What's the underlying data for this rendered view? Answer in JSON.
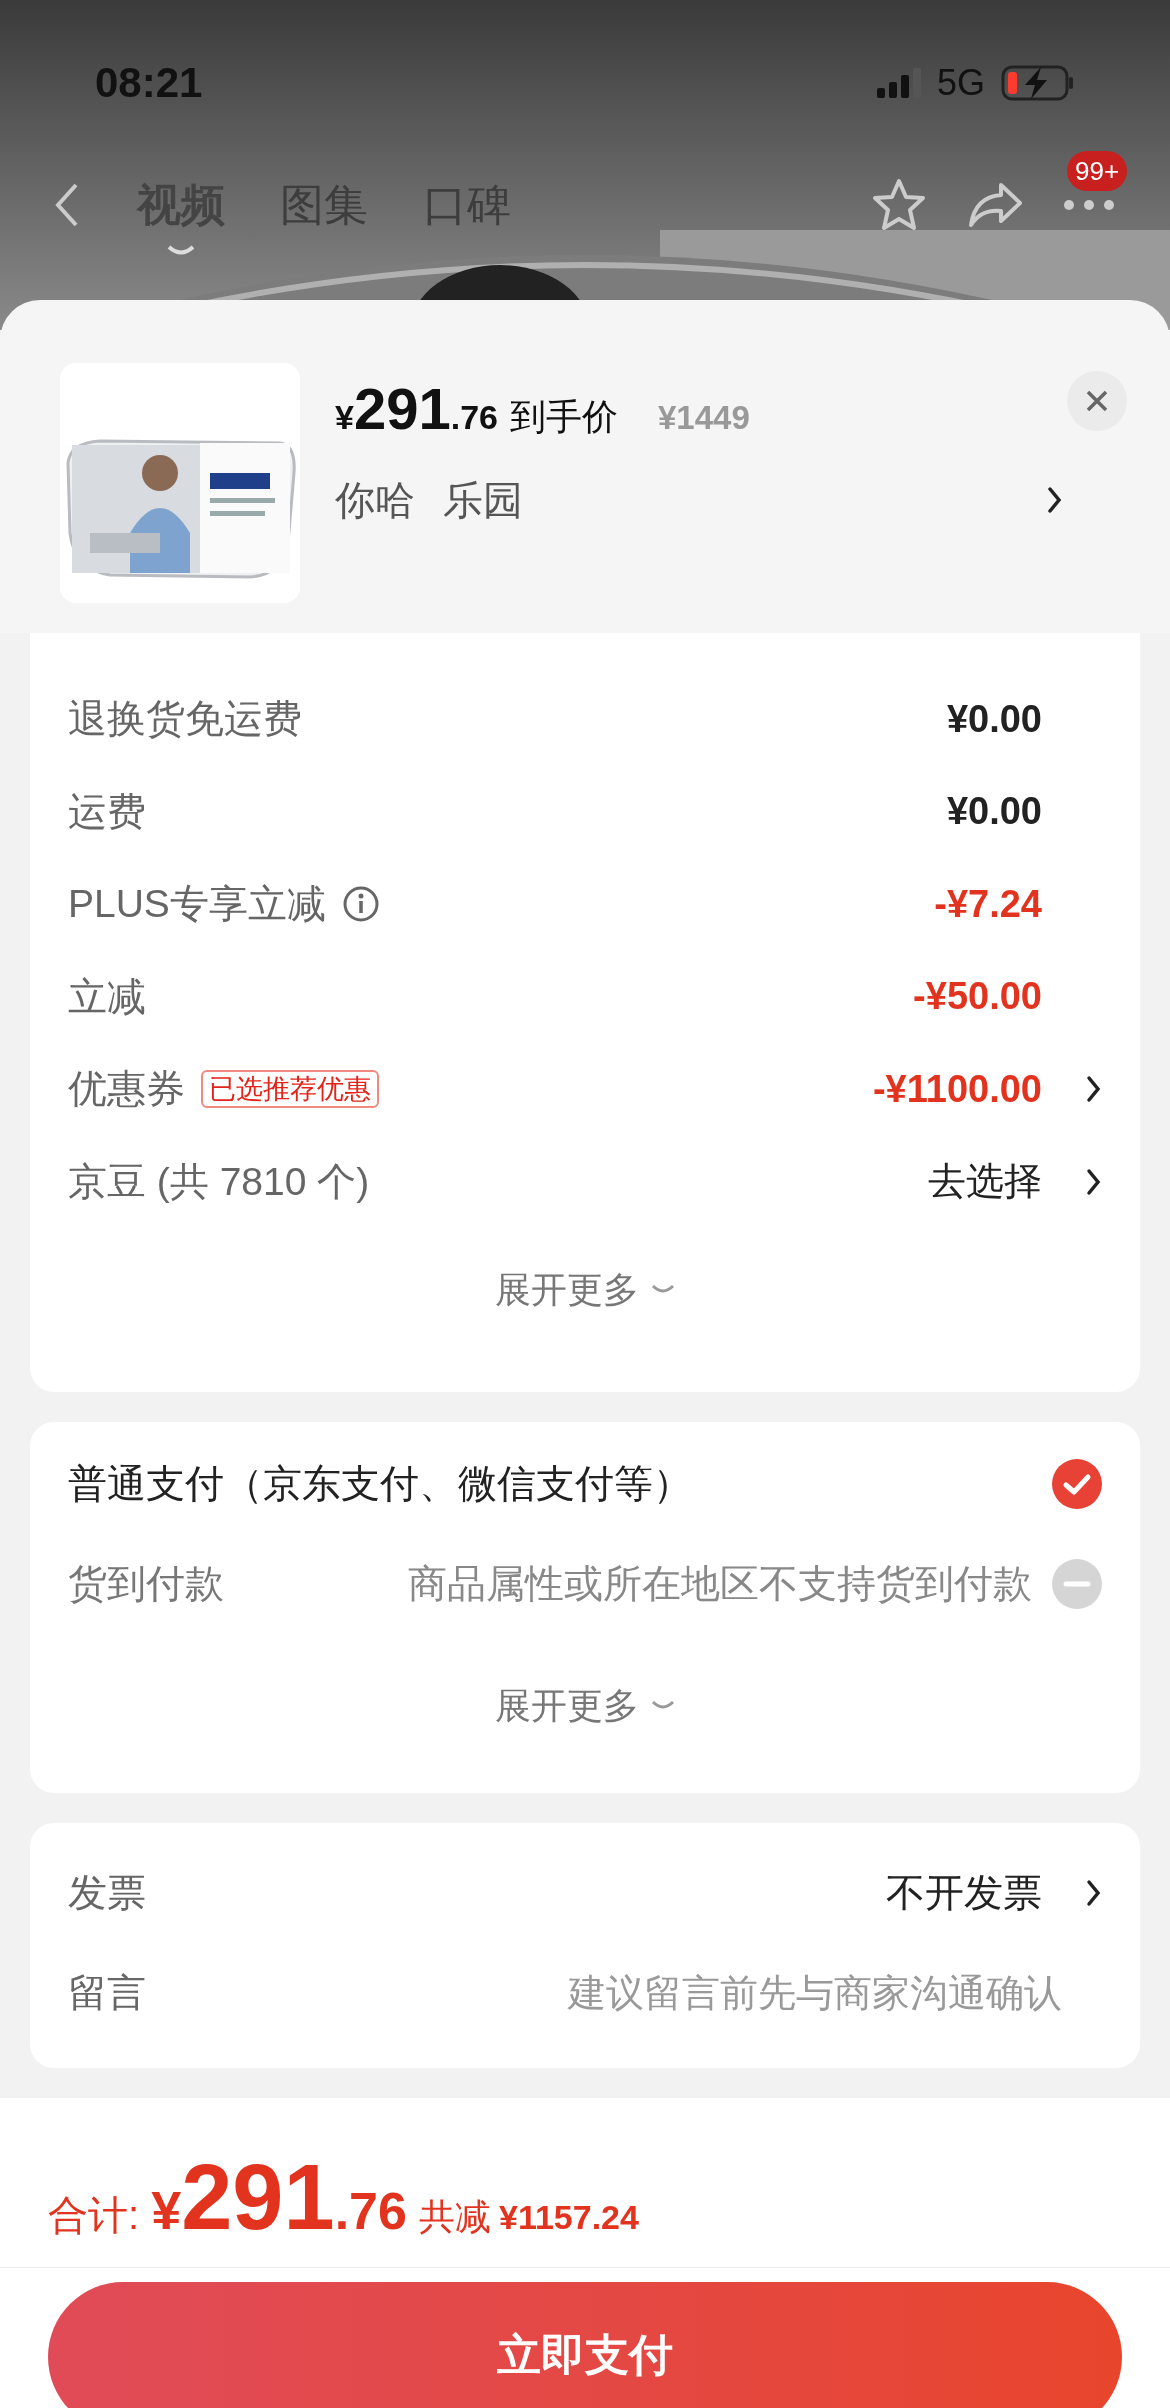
{
  "status_bar": {
    "time": "08:21",
    "network": "5G"
  },
  "nav": {
    "tabs": [
      {
        "label": "视频",
        "selected": true
      },
      {
        "label": "图集",
        "selected": false
      },
      {
        "label": "口碑",
        "selected": false
      }
    ],
    "badge": "99+"
  },
  "product": {
    "currency": "¥",
    "price_int": "291",
    "price_dec": ".76",
    "price_label": "到手价",
    "original_price": "¥1449",
    "variants": [
      "你哈",
      "乐园"
    ]
  },
  "charges": [
    {
      "label": "退换货免运费",
      "value": "¥0.00",
      "highlight": false,
      "link": false
    },
    {
      "label": "运费",
      "value": "¥0.00",
      "highlight": false,
      "link": false
    },
    {
      "label": "PLUS专享立减",
      "value": "-¥7.24",
      "highlight": true,
      "info": true,
      "link": false
    },
    {
      "label": "立减",
      "value": "-¥50.00",
      "highlight": true,
      "link": false
    },
    {
      "label": "优惠券",
      "tag": "已选推荐优惠",
      "value": "-¥1100.00",
      "highlight": true,
      "link": true
    },
    {
      "label": "京豆 (共 7810 个)",
      "value": "去选择",
      "highlight": false,
      "link": true
    }
  ],
  "charges_expand": "展开更多",
  "payment": {
    "options": [
      {
        "label": "普通支付（京东支付、微信支付等）",
        "selected": true,
        "disabled": false
      },
      {
        "label": "货到付款",
        "note": "商品属性或所在地区不支持货到付款",
        "selected": false,
        "disabled": true
      }
    ],
    "expand": "展开更多"
  },
  "invoice": {
    "label": "发票",
    "value": "不开发票"
  },
  "message": {
    "label": "留言",
    "placeholder": "建议留言前先与商家沟通确认"
  },
  "total": {
    "label": "合计:",
    "currency": "¥",
    "int": "291",
    "dec": ".76",
    "saved_label": "共减",
    "saved": "¥1157.24"
  },
  "pay_button": "立即支付"
}
